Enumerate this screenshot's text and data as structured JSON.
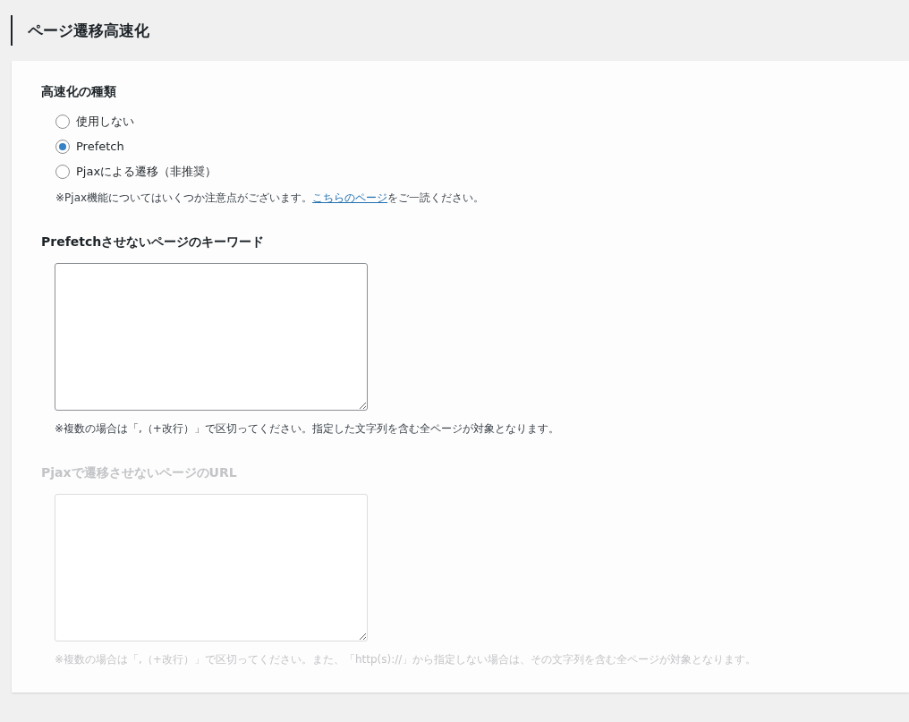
{
  "page_title": "ページ遷移高速化",
  "speed_type": {
    "label": "高速化の種類",
    "options": [
      {
        "label": "使用しない",
        "selected": false
      },
      {
        "label": "Prefetch",
        "selected": true
      },
      {
        "label": "Pjaxによる遷移（非推奨）",
        "selected": false
      }
    ],
    "note": {
      "before": "※Pjax機能についてはいくつか注意点がございます。",
      "link": "こちらのページ",
      "after": "をご一読ください。"
    }
  },
  "fields": [
    {
      "label": "Prefetchさせないページのキーワード",
      "disabled": false,
      "note": "※複数の場合は「,（+改行）」で区切ってください。指定した文字列を含む全ページが対象となります。"
    },
    {
      "label": "Pjaxで遷移させないページのURL",
      "disabled": true,
      "note": "※複数の場合は「,（+改行）」で区切ってください。また、「http(s)://」から指定しない場合は、その文字列を含む全ページが対象となります。"
    }
  ]
}
